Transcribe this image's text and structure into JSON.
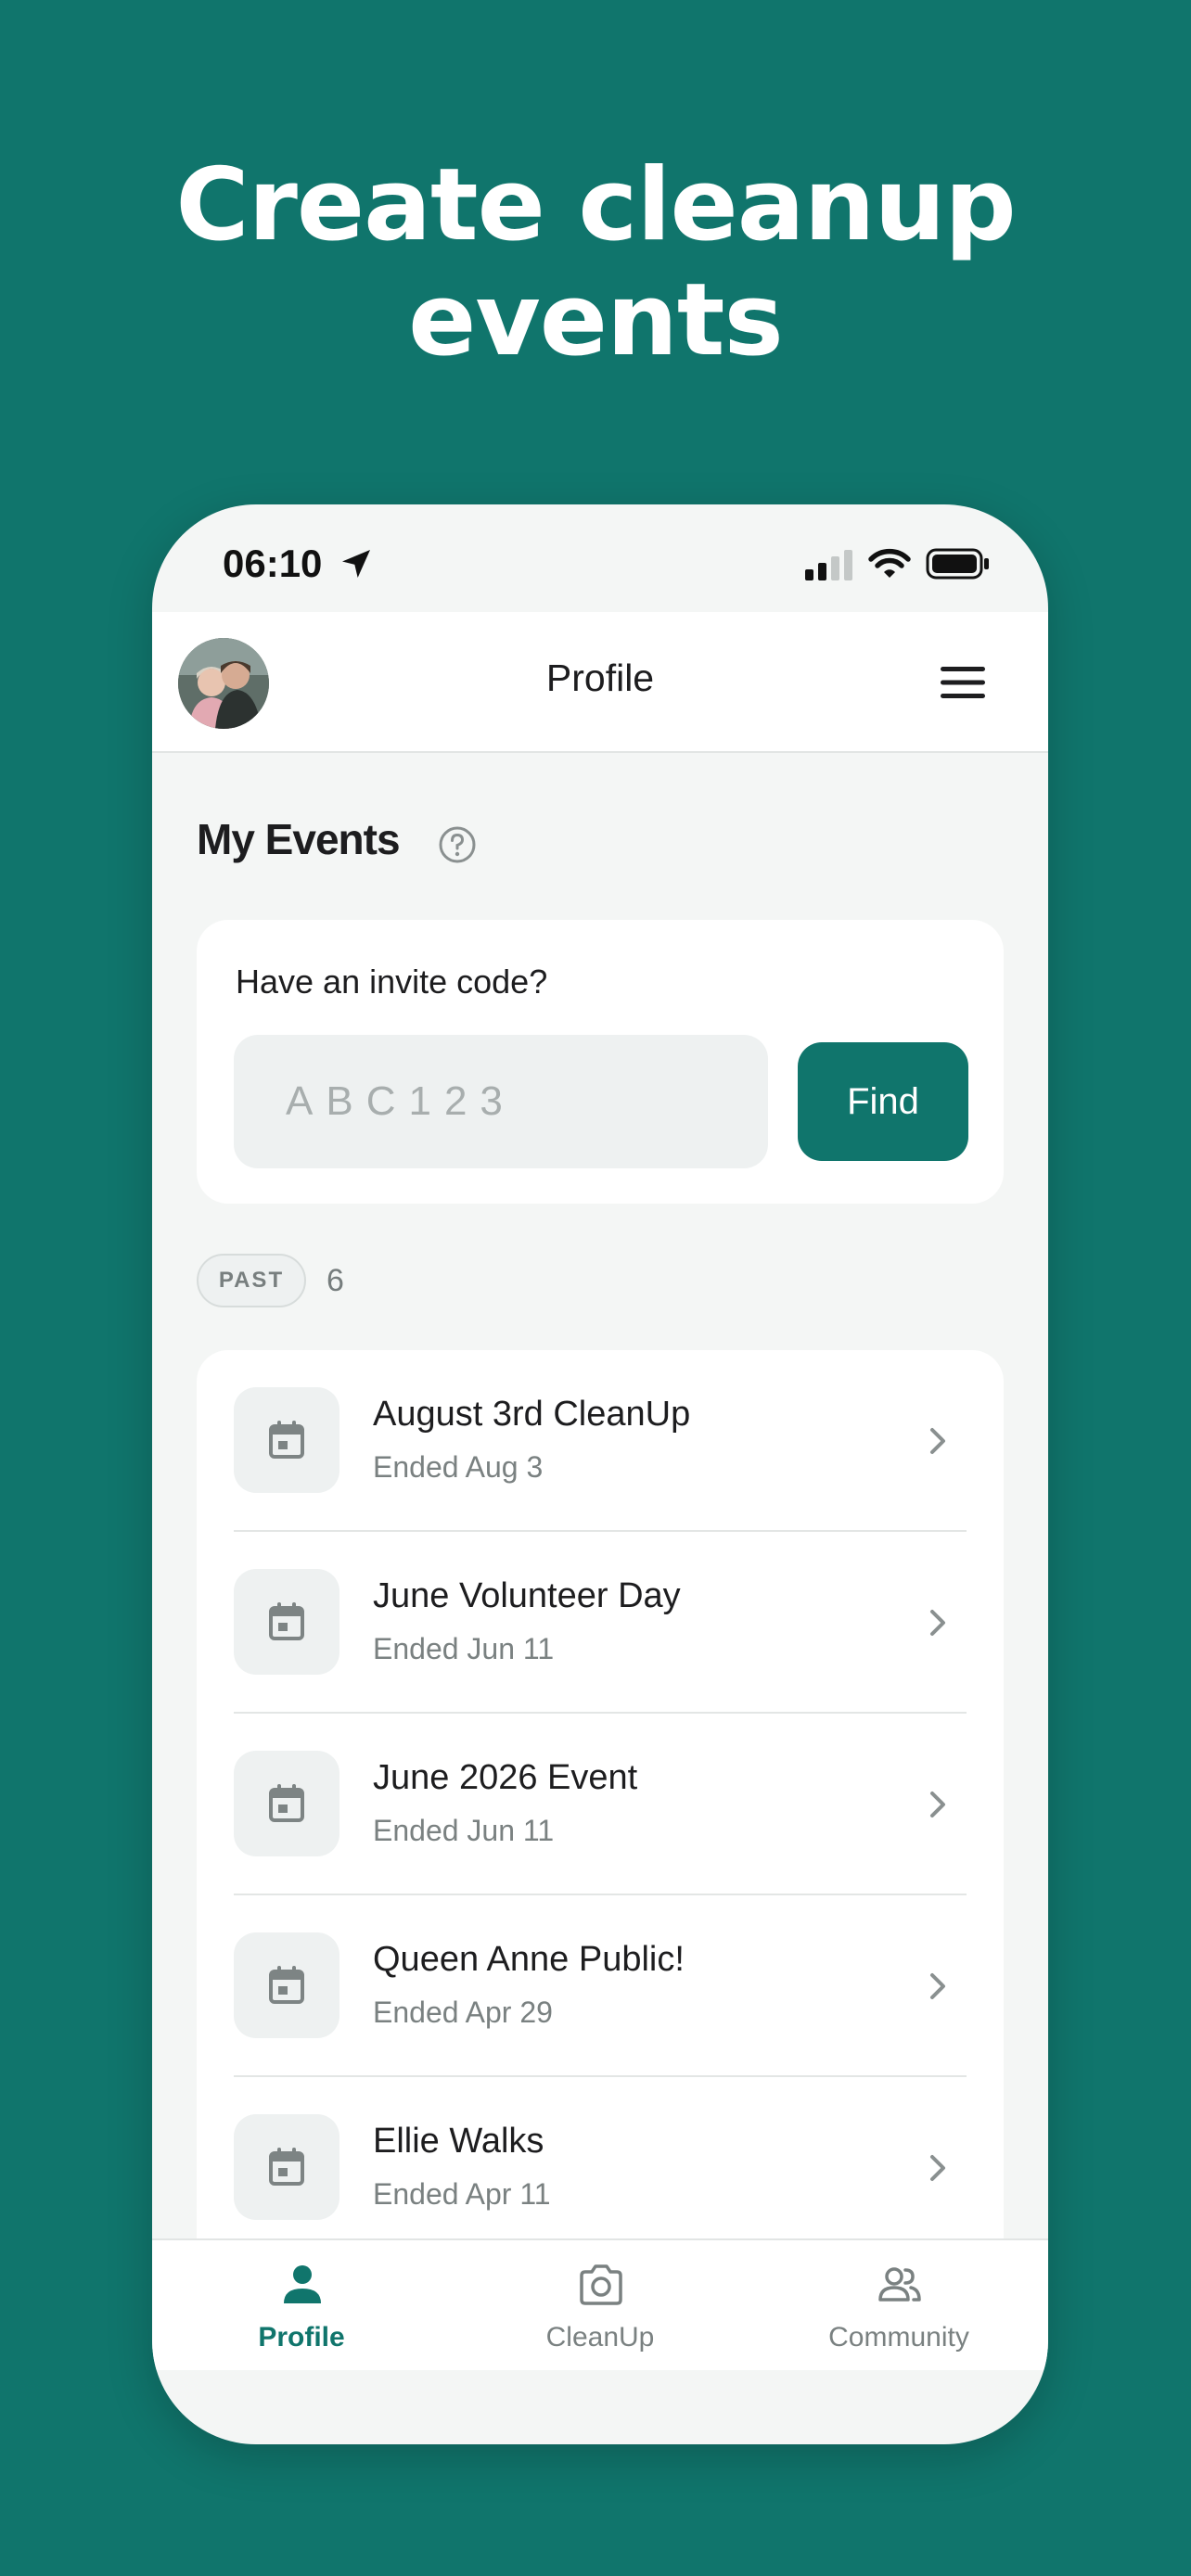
{
  "headline": {
    "line1": "Create cleanup",
    "line2": "events"
  },
  "status_bar": {
    "time": "06:10"
  },
  "header": {
    "title": "Profile"
  },
  "my_events": {
    "title": "My Events"
  },
  "invite": {
    "label": "Have an invite code?",
    "placeholder": "ABC123",
    "value": "",
    "find_label": "Find"
  },
  "past": {
    "badge": "PAST",
    "count": "6"
  },
  "events": [
    {
      "name": "August 3rd CleanUp",
      "status": "Ended Aug 3"
    },
    {
      "name": "June Volunteer Day",
      "status": "Ended Jun 11"
    },
    {
      "name": "June 2026 Event",
      "status": "Ended Jun 11"
    },
    {
      "name": "Queen Anne Public!",
      "status": "Ended Apr 29"
    },
    {
      "name": "Ellie Walks",
      "status": "Ended Apr 11"
    },
    {
      "name": "",
      "status": ""
    }
  ],
  "tabs": [
    {
      "label": "Profile",
      "icon": "person-icon",
      "active": true
    },
    {
      "label": "CleanUp",
      "icon": "camera-icon",
      "active": false
    },
    {
      "label": "Community",
      "icon": "people-icon",
      "active": false
    }
  ],
  "colors": {
    "background": "#10756c",
    "accent": "#10756c",
    "inactive": "#7a8181",
    "surface": "#f4f6f5"
  }
}
